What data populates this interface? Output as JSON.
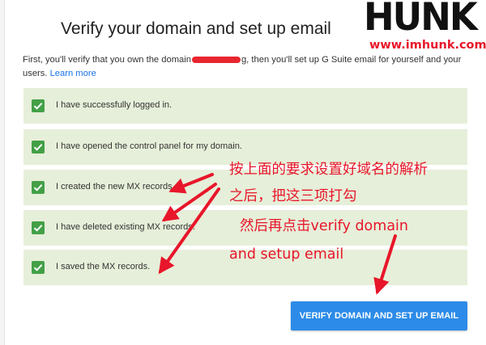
{
  "dialog": {
    "title": "Verify your domain and set up email",
    "intro_before": "First, you'll verify that you own the domain",
    "intro_after": "g, then you'll set up G Suite email for yourself and your users.",
    "learn_more": "Learn more"
  },
  "steps": [
    {
      "label": "I have successfully logged in.",
      "checked": true
    },
    {
      "label": "I have opened the control panel for my domain.",
      "checked": true
    },
    {
      "label": "I created the new MX records.",
      "checked": true
    },
    {
      "label": "I have deleted existing MX records.",
      "checked": true
    },
    {
      "label": "I saved the MX records.",
      "checked": true
    }
  ],
  "button": {
    "label": "VERIFY DOMAIN AND SET UP EMAIL"
  },
  "annotation": {
    "lines": [
      "按上面的要求设置好域名的解析",
      "之后，把这三项打勾",
      "然后再点击verify domain",
      "and setup email"
    ],
    "color": "#e8162a"
  },
  "watermark": {
    "logo": "HUNK",
    "url": "www.imhunk.com"
  },
  "colors": {
    "step_bg": "#e6efd9",
    "check": "#43a047",
    "button": "#2c8be8",
    "link": "#1a73e8"
  }
}
